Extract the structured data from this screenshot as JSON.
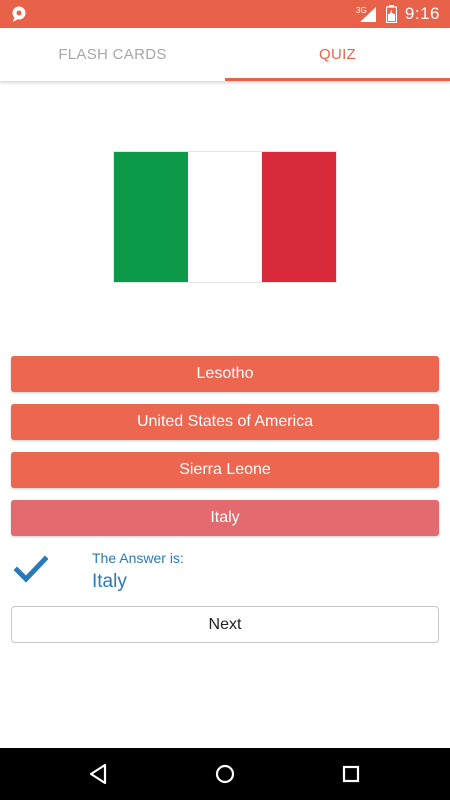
{
  "status_bar": {
    "time": "9:16",
    "network_label": "3G",
    "icons": [
      "chat-bubble-icon",
      "signal-icon",
      "battery-icon"
    ]
  },
  "tabs": [
    {
      "label": "FLASH CARDS",
      "active": false
    },
    {
      "label": "QUIZ",
      "active": true
    }
  ],
  "flag": {
    "colors": [
      "#0d9a48",
      "#ffffff",
      "#d92a3b"
    ]
  },
  "answers": [
    {
      "label": "Lesotho"
    },
    {
      "label": "United States of America"
    },
    {
      "label": "Sierra Leone"
    },
    {
      "label": "Italy"
    }
  ],
  "result": {
    "label": "The Answer is:",
    "value": "Italy",
    "icon": "checkmark-icon"
  },
  "next_button": {
    "label": "Next"
  },
  "navigation": {
    "icons": [
      "back-icon",
      "home-icon",
      "recent-apps-icon"
    ]
  },
  "colors": {
    "accent": "#e8624a",
    "answer_button": "#ec6650",
    "selected_answer": "#e36a6e",
    "answer_text": "#2a7ab8",
    "inactive_tab": "#a8a8a8"
  }
}
